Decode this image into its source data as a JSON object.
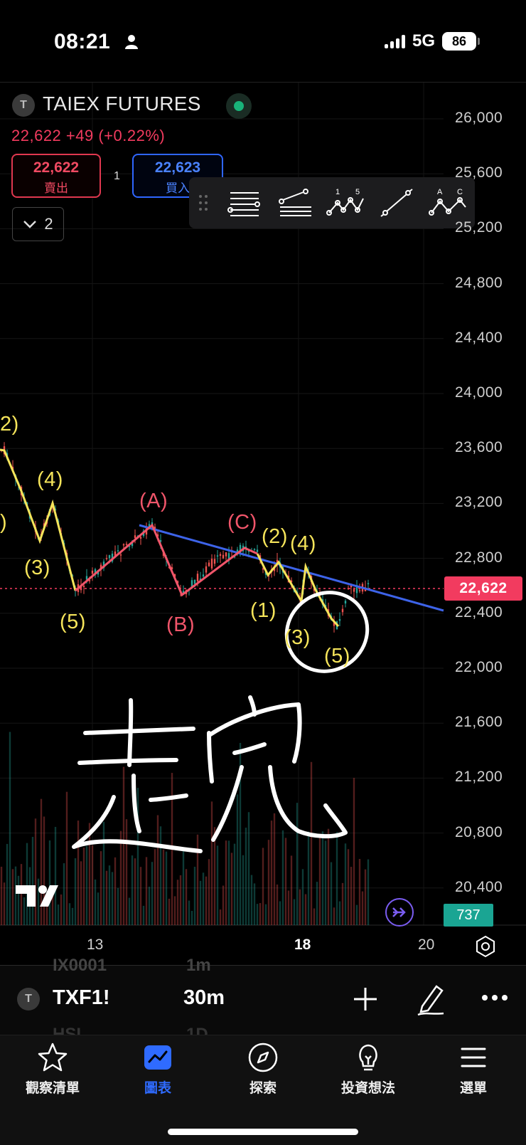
{
  "status_bar": {
    "time": "08:21",
    "network": "5G",
    "battery": "86"
  },
  "header": {
    "logo_letter": "T",
    "symbol_name": "TAIEX FUTURES",
    "price_change": "22,622 +49 (+0.22%)",
    "sell": {
      "price": "22,622",
      "label": "賣出"
    },
    "buy": {
      "price": "22,623",
      "label": "買入"
    },
    "spread": "1",
    "indicators_count": "2"
  },
  "drawing_toolbar": {
    "tools": [
      "horizontal-lines-icon",
      "fib-retracement-icon",
      "elliott-impulse-icon",
      "trend-line-icon",
      "elliott-correction-icon"
    ],
    "impulse_labels": [
      "1",
      "5"
    ],
    "correction_labels": [
      "A",
      "C"
    ]
  },
  "chart": {
    "y_ticks": [
      "26,000",
      "25,600",
      "25,200",
      "24,800",
      "24,400",
      "24,000",
      "23,600",
      "23,200",
      "22,800",
      "22,400",
      "22,000",
      "21,600",
      "21,200",
      "20,800",
      "20,400"
    ],
    "x_ticks": [
      "13",
      "18",
      "20"
    ],
    "last_price": "22,622",
    "volume": "737",
    "colors": {
      "up": "#26a69a",
      "down": "#ef5350",
      "trendline": "#3d63e8",
      "wave_yellow": "#f5e45a",
      "wave_red": "#f0556a"
    },
    "wave_labels_yellow": [
      "2)",
      "(4)",
      ")",
      "(3)",
      "(5)",
      "(2)",
      "(4)",
      "(1)",
      "(3)",
      "(5)"
    ],
    "wave_labels_red": [
      "(A)",
      "(C)",
      "(B)"
    ],
    "handwriting": "走完"
  },
  "symbol_bar": {
    "logo_letter": "T",
    "symbol": "TXF1!",
    "interval": "30m",
    "ghost_above": [
      "IX0001",
      "1m"
    ],
    "ghost_below": [
      "HSI",
      "1D"
    ]
  },
  "tabs": [
    {
      "label": "觀察清單",
      "icon": "star-icon",
      "active": false
    },
    {
      "label": "圖表",
      "icon": "chart-icon",
      "active": true
    },
    {
      "label": "探索",
      "icon": "compass-icon",
      "active": false
    },
    {
      "label": "投資想法",
      "icon": "lightbulb-icon",
      "active": false
    },
    {
      "label": "選單",
      "icon": "menu-icon",
      "active": false
    }
  ]
}
